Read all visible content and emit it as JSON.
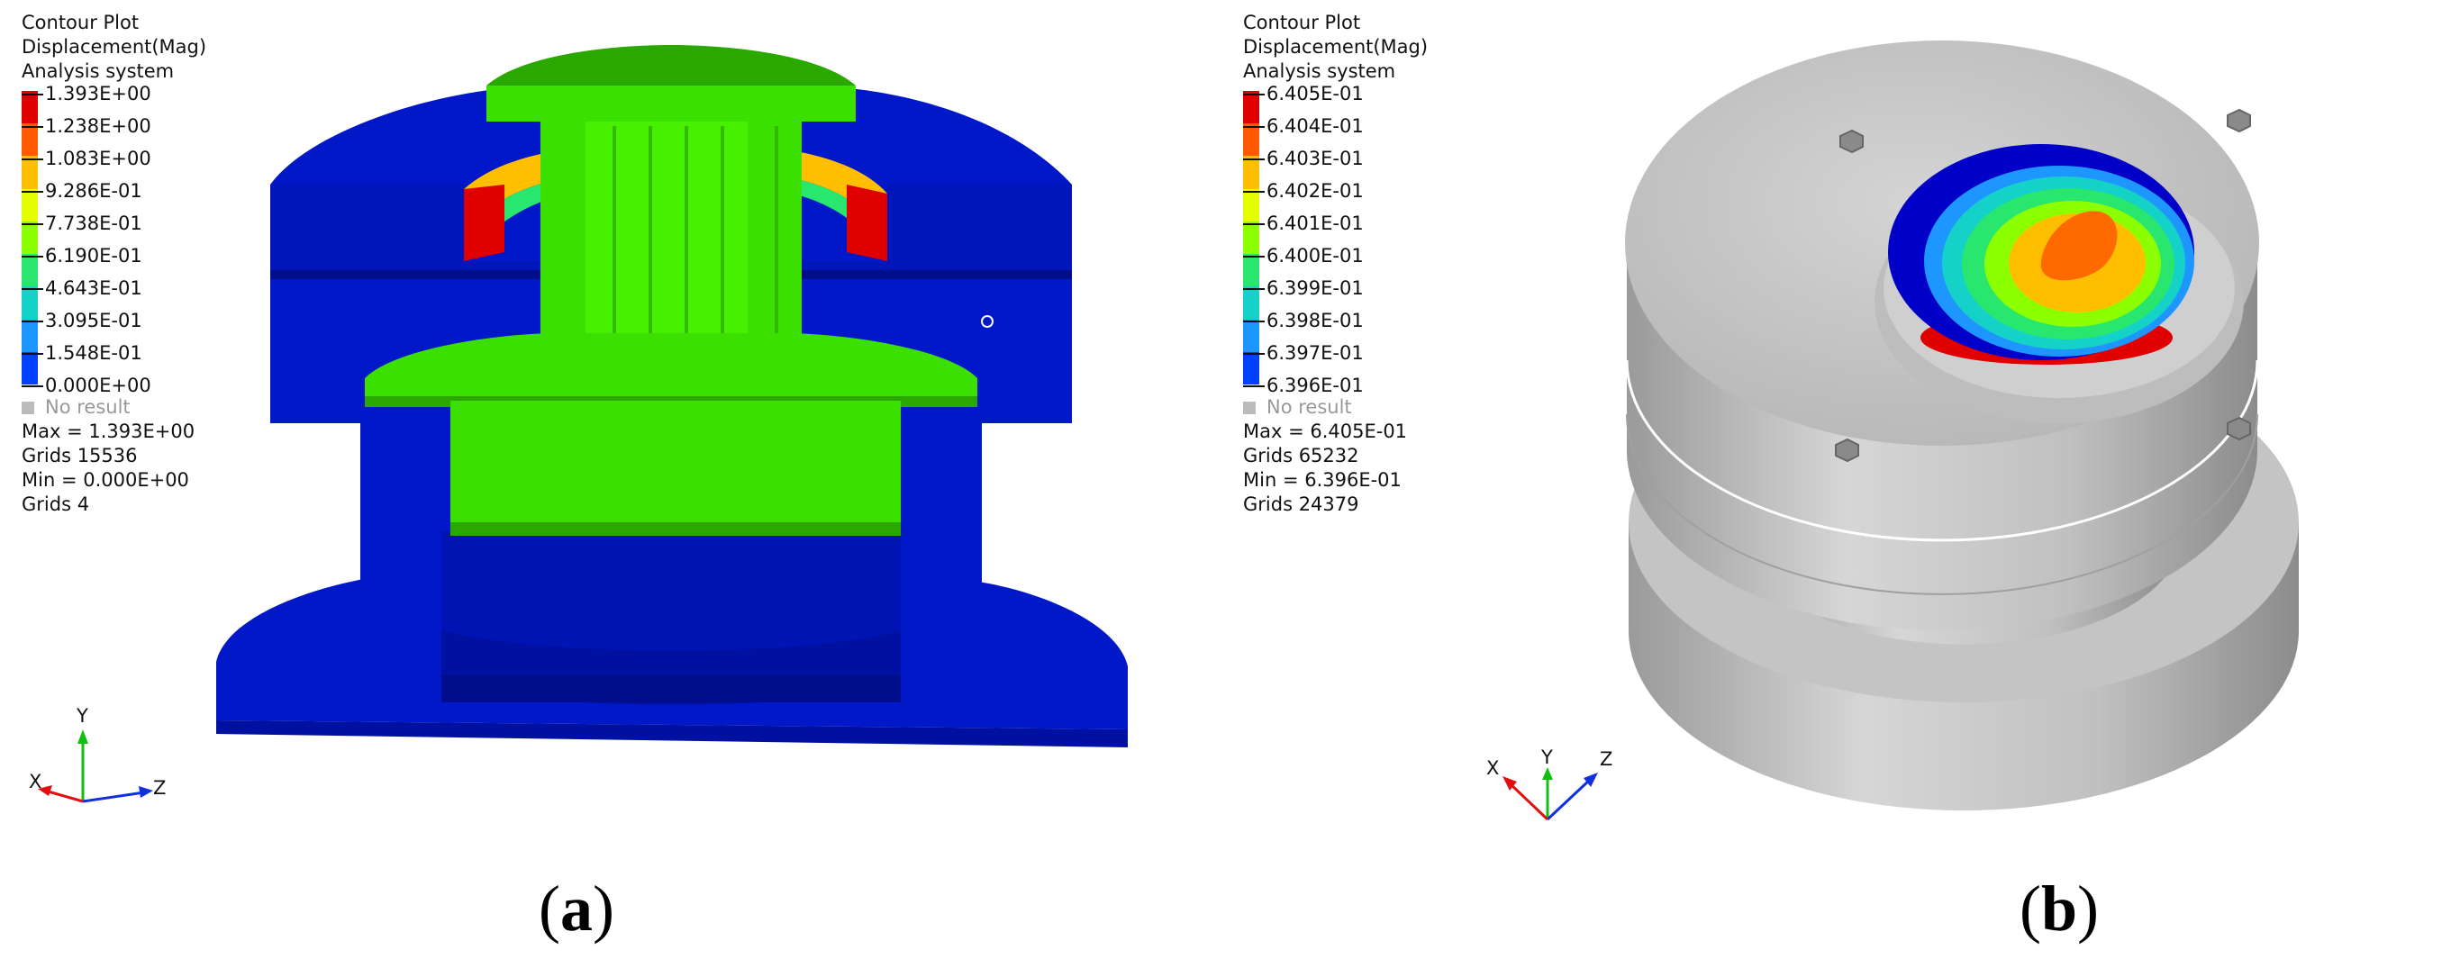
{
  "panel_a": {
    "legend_title": [
      "Contour Plot",
      "Displacement(Mag)",
      "Analysis system"
    ],
    "scale_labels": [
      "1.393E+00",
      "1.238E+00",
      "1.083E+00",
      "9.286E-01",
      "7.738E-01",
      "6.190E-01",
      "4.643E-01",
      "3.095E-01",
      "1.548E-01",
      "0.000E+00"
    ],
    "scale_colors": [
      "#e00000",
      "#ff5a00",
      "#ffbf00",
      "#e6ff00",
      "#8cff00",
      "#28e66e",
      "#14d2c8",
      "#1e96ff",
      "#0040ff",
      "#0000c8"
    ],
    "no_result": "No result",
    "stats": [
      "Max = 1.393E+00",
      "Grids 15536",
      "Min = 0.000E+00",
      "Grids 4"
    ],
    "axes": {
      "x": "X",
      "y": "Y",
      "z": "Z"
    },
    "caption_letter": "a"
  },
  "panel_b": {
    "legend_title": [
      "Contour Plot",
      "Displacement(Mag)",
      "Analysis system"
    ],
    "scale_labels": [
      "6.405E-01",
      "6.404E-01",
      "6.403E-01",
      "6.402E-01",
      "6.401E-01",
      "6.400E-01",
      "6.399E-01",
      "6.398E-01",
      "6.397E-01",
      "6.396E-01"
    ],
    "scale_colors": [
      "#e00000",
      "#ff5a00",
      "#ffbf00",
      "#e6ff00",
      "#8cff00",
      "#28e66e",
      "#14d2c8",
      "#1e96ff",
      "#0040ff",
      "#0000c8"
    ],
    "no_result": "No result",
    "stats": [
      "Max = 6.405E-01",
      "Grids 65232",
      "Min = 6.396E-01",
      "Grids 24379"
    ],
    "axes": {
      "x": "X",
      "y": "Y",
      "z": "Z"
    },
    "caption_letter": "b"
  },
  "colors": {
    "deep_blue": "#0018c8",
    "dark_blue": "#0010a0",
    "green": "#3ce000",
    "dark_green": "#2aa800",
    "grey": "#c8c8c8"
  }
}
